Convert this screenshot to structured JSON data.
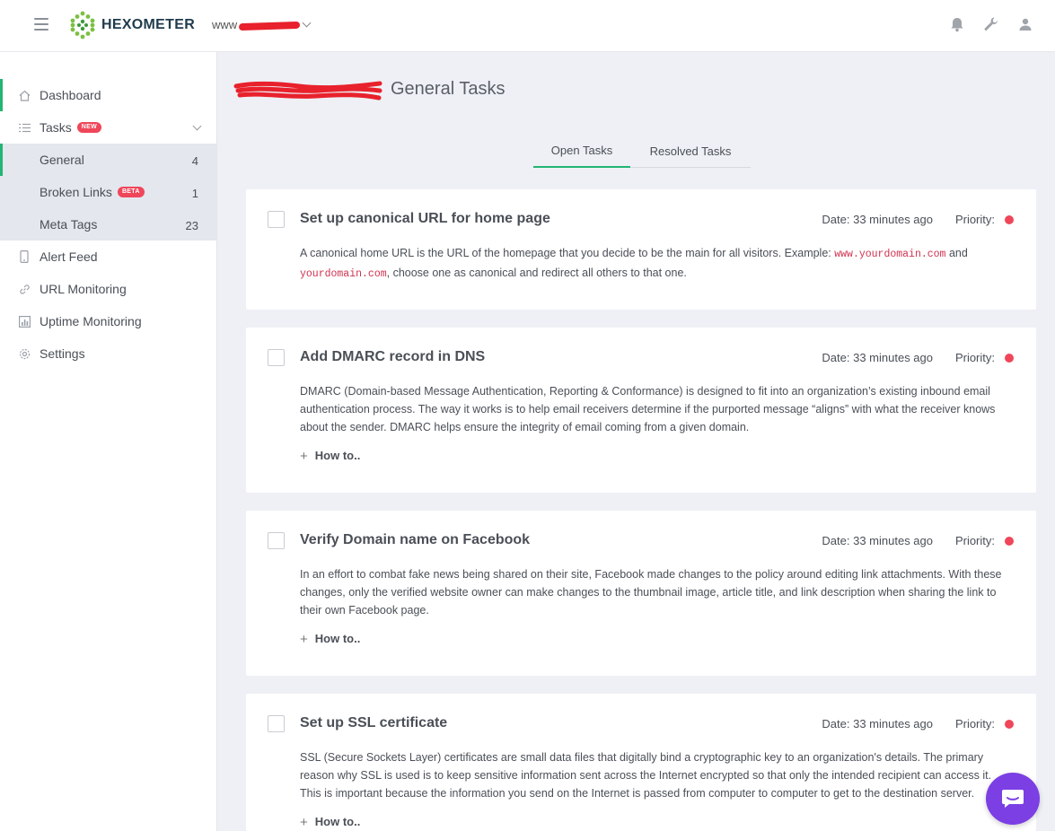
{
  "header": {
    "brand": "HEXOMETER",
    "domain_prefix": "www",
    "icons": [
      "bell-icon",
      "wrench-icon",
      "user-icon"
    ]
  },
  "sidebar": {
    "items": [
      {
        "label": "Dashboard",
        "icon": "home-icon"
      },
      {
        "label": "Tasks",
        "badge": "NEW",
        "icon": "list-icon"
      },
      {
        "label": "Alert Feed",
        "icon": "phone-icon"
      },
      {
        "label": "URL Monitoring",
        "icon": "link-icon"
      },
      {
        "label": "Uptime Monitoring",
        "icon": "chart-icon"
      },
      {
        "label": "Settings",
        "icon": "gear-icon"
      }
    ],
    "subitems": [
      {
        "label": "General",
        "count": "4"
      },
      {
        "label": "Broken Links",
        "badge": "BETA",
        "count": "1"
      },
      {
        "label": "Meta Tags",
        "count": "23"
      }
    ]
  },
  "main": {
    "title": "General Tasks",
    "tabs": [
      "Open Tasks",
      "Resolved Tasks"
    ],
    "tasks": [
      {
        "title": "Set up canonical URL for home page",
        "date": "Date: 33 minutes ago",
        "priority": "Priority:",
        "desc_a": "A canonical home URL is the URL of the homepage that you decide to be the main for all visitors. Example: ",
        "code_a": "www.yourdomain.com",
        "desc_b": " and ",
        "code_b": "yourdomain.com",
        "desc_c": ", choose one as canonical and redirect all others to that one."
      },
      {
        "title": "Add DMARC record in DNS",
        "date": "Date: 33 minutes ago",
        "priority": "Priority:",
        "desc": "DMARC (Domain-based Message Authentication, Reporting & Conformance) is designed to fit into an organization’s existing inbound email authentication process. The way it works is to help email receivers determine if the purported message “aligns” with what the receiver knows about the sender. DMARC helps ensure the integrity of email coming from a given domain.",
        "howto": "How to.."
      },
      {
        "title": "Verify Domain name on Facebook",
        "date": "Date: 33 minutes ago",
        "priority": "Priority:",
        "desc": "In an effort to combat fake news being shared on their site, Facebook made changes to the policy around editing link attachments. With these changes, only the verified website owner can make changes to the thumbnail image, article title, and link description when sharing the link to their own Facebook page.",
        "howto": "How to.."
      },
      {
        "title": "Set up SSL certificate",
        "date": "Date: 33 minutes ago",
        "priority": "Priority:",
        "desc": "SSL (Secure Sockets Layer) certificates are small data files that digitally bind a cryptographic key to an organization's details. The primary reason why SSL is used is to keep sensitive information sent across the Internet encrypted so that only the intended recipient can access it. This is important because the information you send on the Internet is passed from computer to computer to get to the destination server.",
        "howto": "How to.."
      }
    ]
  },
  "colors": {
    "accent": "#22b573",
    "priority_high": "#f0465a",
    "chat": "#7b3fe4"
  }
}
